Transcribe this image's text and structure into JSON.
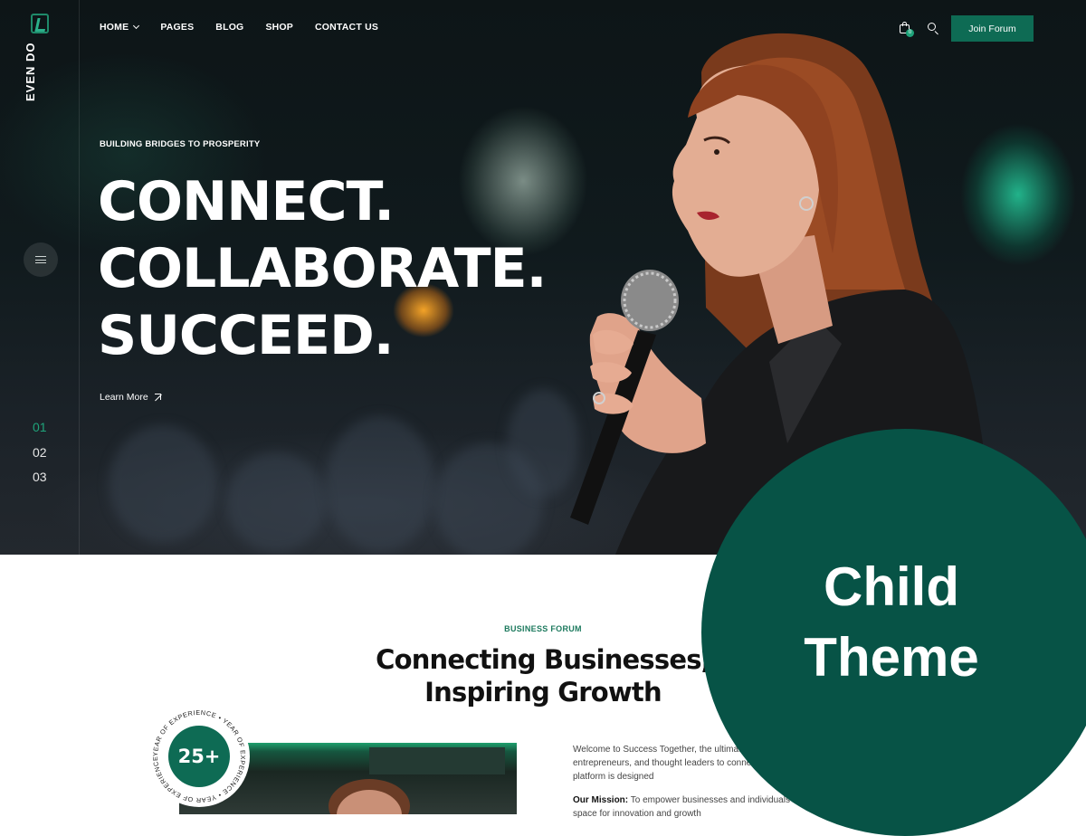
{
  "brand": {
    "logo_text": "EVEN DO"
  },
  "nav": {
    "items": [
      {
        "label": "HOME",
        "has_dropdown": true
      },
      {
        "label": "PAGES",
        "has_dropdown": false
      },
      {
        "label": "BLOG",
        "has_dropdown": false
      },
      {
        "label": "SHOP",
        "has_dropdown": false
      },
      {
        "label": "CONTACT US",
        "has_dropdown": false
      }
    ],
    "cart_count": "0",
    "join_label": "Join Forum"
  },
  "hero": {
    "eyebrow": "BUILDING BRIDGES TO PROSPERITY",
    "headline_lines": [
      "CONNECT.",
      "COLLABORATE.",
      "SUCCEED."
    ],
    "cta": "Learn More",
    "slides": [
      "01",
      "02",
      "03"
    ],
    "active_slide": "01"
  },
  "about": {
    "eyebrow": "BUSINESS FORUM",
    "title_lines": [
      "Connecting Businesses,",
      "Inspiring Growth"
    ],
    "experience_value": "25+",
    "experience_ring_text": "YEAR OF EXPERIENCE • YEAR OF EXPERIENCE • YEAR OF EXPERIENCE •",
    "intro_lines": [
      "Welcome to Success Together, the ultimate",
      "entrepreneurs, and thought leaders to connect",
      "platform is designed"
    ],
    "mission_label": "Our Mission:",
    "mission_lines": [
      "To empower businesses and individuals by cre",
      "space for innovation and growth"
    ]
  },
  "overlay": {
    "line1": "Child",
    "line2": "Theme"
  },
  "colors": {
    "accent": "#0e6b54",
    "overlay_circle": "#075346",
    "active_slide": "#1fa37a"
  }
}
